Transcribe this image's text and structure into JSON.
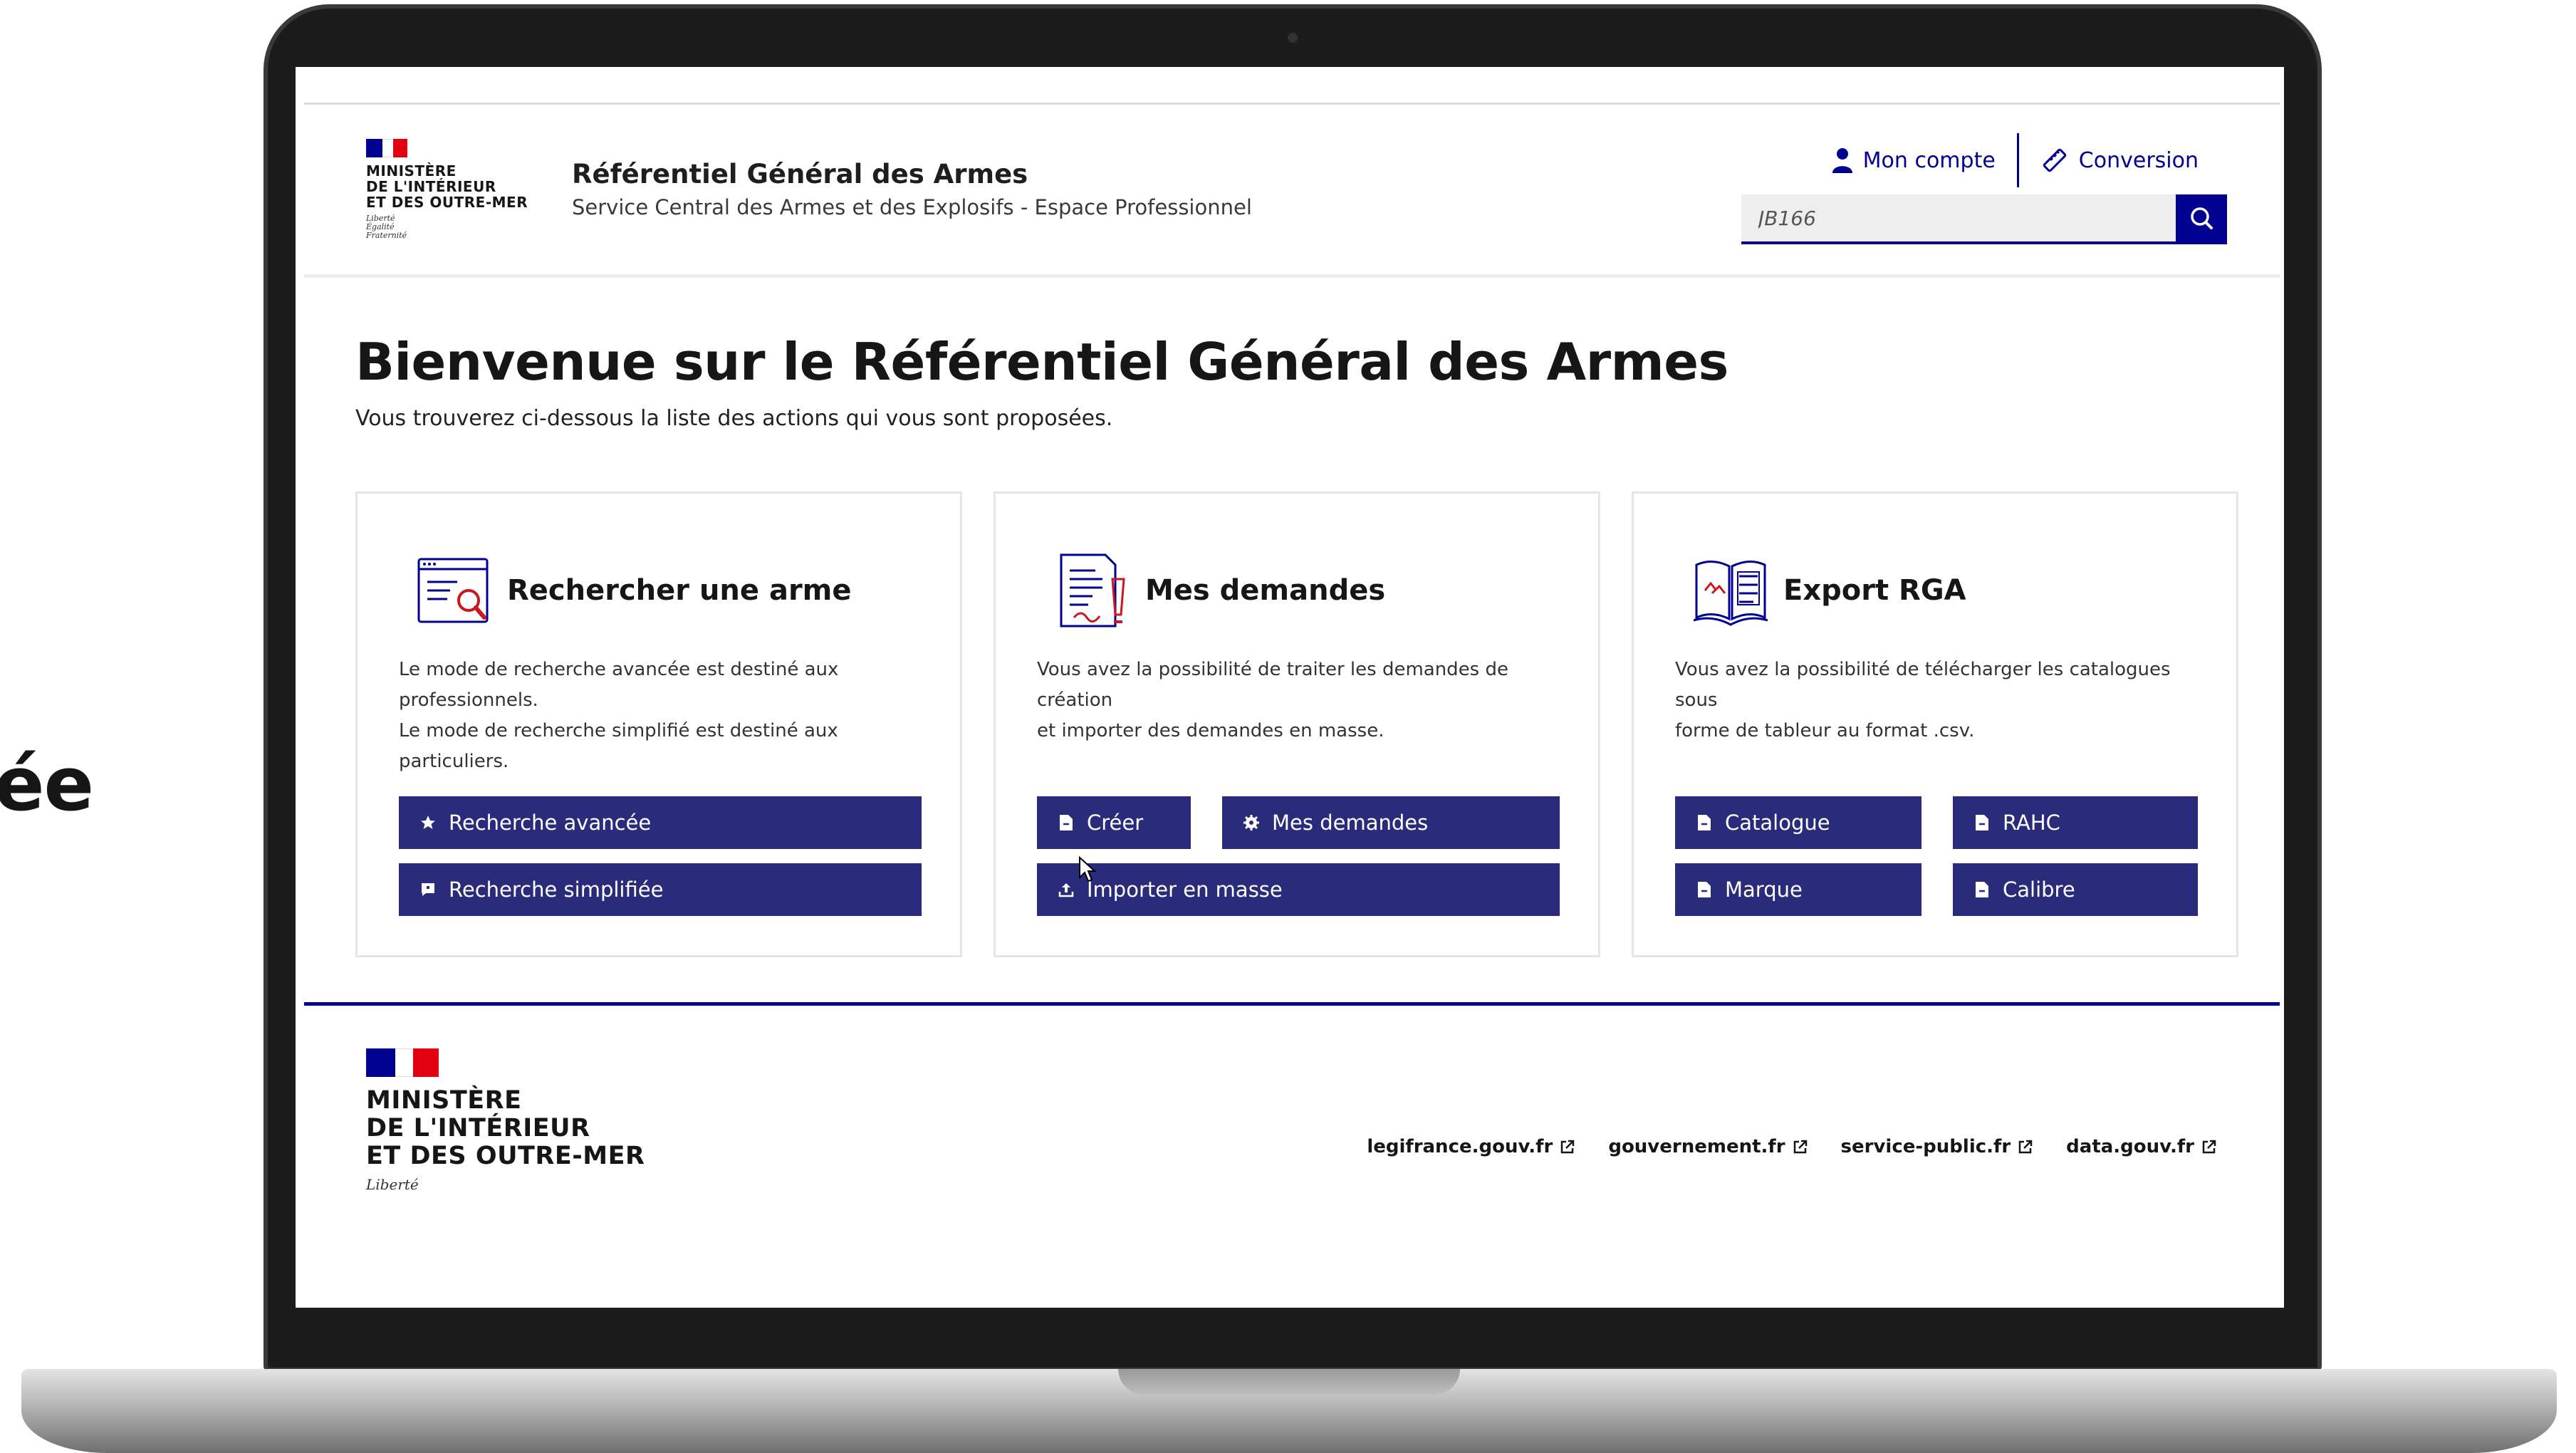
{
  "slide": {
    "fragment": "ée"
  },
  "header": {
    "ministry_lines": [
      "MINISTÈRE",
      "DE L'INTÉRIEUR",
      "ET DES OUTRE-MER"
    ],
    "motto_lines": [
      "Liberté",
      "Égalité",
      "Fraternité"
    ],
    "title": "Référentiel Général des Armes",
    "subtitle": "Service Central des Armes et des Explosifs - Espace Professionnel",
    "account_label": "Mon compte",
    "conversion_label": "Conversion",
    "search_value": "JB166"
  },
  "main": {
    "title": "Bienvenue sur le Référentiel Général des Armes",
    "lead": "Vous trouverez ci-dessous la liste des actions qui vous sont proposées.",
    "cards": [
      {
        "title": "Rechercher une arme",
        "icon": "search-document-icon",
        "desc_lines": [
          "Le mode de recherche avancée est destiné aux",
          "professionnels.",
          "Le mode de recherche simplifié est destiné aux particuliers."
        ],
        "buttons": [
          {
            "label": "Recherche avancée",
            "icon": "star-icon"
          },
          {
            "label": "Recherche simplifiée",
            "icon": "bookmark-icon"
          }
        ]
      },
      {
        "title": "Mes demandes",
        "icon": "signed-document-icon",
        "desc_lines": [
          "Vous avez la possibilité de traiter les demandes de création",
          "et importer des demandes en masse."
        ],
        "buttons": [
          {
            "label": "Créer",
            "icon": "file-icon"
          },
          {
            "label": "Mes demandes",
            "icon": "gear-icon"
          },
          {
            "label": "Importer en masse",
            "icon": "upload-icon"
          }
        ]
      },
      {
        "title": "Export RGA",
        "icon": "open-book-icon",
        "desc_lines": [
          "Vous avez la possibilité de télécharger les catalogues sous",
          "forme de tableur au format .csv."
        ],
        "buttons": [
          {
            "label": "Catalogue",
            "icon": "file-icon"
          },
          {
            "label": "RAHC",
            "icon": "file-icon"
          },
          {
            "label": "Marque",
            "icon": "file-icon"
          },
          {
            "label": "Calibre",
            "icon": "file-icon"
          }
        ]
      }
    ]
  },
  "footer": {
    "ministry_lines": [
      "MINISTÈRE",
      "DE L'INTÉRIEUR",
      "ET DES OUTRE-MER"
    ],
    "motto": "Liberté",
    "links": [
      "legifrance.gouv.fr",
      "gouvernement.fr",
      "service-public.fr",
      "data.gouv.fr"
    ]
  },
  "colors": {
    "primary_blue": "#000091",
    "button_blue": "#2b2b7c",
    "marianne_red": "#e1000f",
    "icon_red": "#c9191e"
  }
}
